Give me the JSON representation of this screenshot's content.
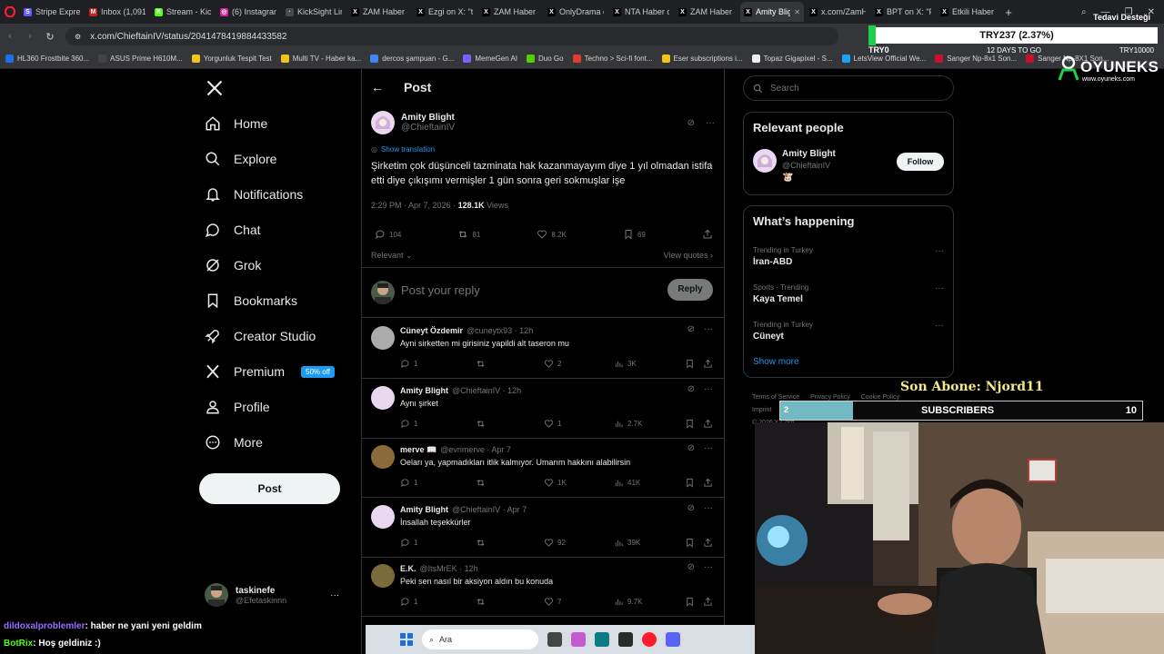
{
  "browser": {
    "tabs": [
      {
        "label": "Stripe Express",
        "color": "#635bff",
        "glyph": "S"
      },
      {
        "label": "Inbox (1,091)",
        "color": "#c5221f",
        "glyph": "M"
      },
      {
        "label": "Stream - Kick",
        "color": "#53fc18",
        "glyph": "K"
      },
      {
        "label": "(6) Instagram",
        "color": "#d6249f",
        "glyph": "◎"
      },
      {
        "label": "KickSight Link",
        "color": "#4a4a4a",
        "glyph": "·"
      },
      {
        "label": "ZAM Haber on",
        "color": "#000000",
        "glyph": "X"
      },
      {
        "label": "Ezgi on X: \"th",
        "color": "#000000",
        "glyph": "X"
      },
      {
        "label": "ZAM Haber on",
        "color": "#000000",
        "glyph": "X"
      },
      {
        "label": "OnlyDrama on",
        "color": "#000000",
        "glyph": "X"
      },
      {
        "label": "NTA Haber on",
        "color": "#000000",
        "glyph": "X"
      },
      {
        "label": "ZAM Haber on",
        "color": "#000000",
        "glyph": "X"
      },
      {
        "label": "Amity Blight on X: \"Şirk",
        "color": "#000000",
        "glyph": "X",
        "active": true
      },
      {
        "label": "x.com/ZamHa",
        "color": "#000000",
        "glyph": "X"
      },
      {
        "label": "BPT on X: \"Flo",
        "color": "#000000",
        "glyph": "X"
      },
      {
        "label": "Etkili Haber Y",
        "color": "#000000",
        "glyph": "X"
      }
    ],
    "url": "x.com/ChieftainIV/status/2041478419884433582",
    "bookmarks": [
      "HL360 Frostbite 360...",
      "ASUS Prime H610M...",
      "Yorgunluk Tespit Test",
      "Multi TV - Haber ka...",
      "dercos şampuan - G...",
      "MemeGen AI",
      "Duo Go",
      "Techno > Sci-fi font...",
      "Eser subscriptions i...",
      "Topaz Gigapixel - S...",
      "LetsView Official We...",
      "Sanger Np-8x1 Son...",
      "Sanger Np-8X1 Son..."
    ]
  },
  "stock_widget": {
    "title": "Tedavi Desteği",
    "value": "TRY237 (2.37%)",
    "low": "TRY0",
    "days": "12 DAYS TO GO",
    "high": "TRY10000",
    "progress": 0.0237
  },
  "brand": {
    "name": "OYUNEKS",
    "url": "www.oyuneks.com"
  },
  "nav": {
    "items": [
      {
        "label": "Home",
        "icon": "home-icon"
      },
      {
        "label": "Explore",
        "icon": "search-icon"
      },
      {
        "label": "Notifications",
        "icon": "bell-icon"
      },
      {
        "label": "Chat",
        "icon": "chat-icon"
      },
      {
        "label": "Grok",
        "icon": "grok-icon"
      },
      {
        "label": "Bookmarks",
        "icon": "bookmark-icon"
      },
      {
        "label": "Creator Studio",
        "icon": "rocket-icon"
      },
      {
        "label": "Premium",
        "icon": "x-logo-icon"
      },
      {
        "label": "Profile",
        "icon": "person-icon"
      },
      {
        "label": "More",
        "icon": "more-circle-icon"
      }
    ],
    "premium_badge": "50% off",
    "post_button": "Post",
    "me": {
      "name": "taskinefe",
      "handle": "@Efetaskinnn"
    }
  },
  "post": {
    "header": "Post",
    "author": "Amity Blight",
    "handle": "@ChieftainIV",
    "show_translation": "Show translation",
    "text": "Şirketim çok düşünceli tazminata hak kazanmayayım diye 1 yıl olmadan istifa etti diye çıkışımı vermişler 1 gün sonra geri sokmuşlar işe",
    "time": "2:29 PM · Apr 7, 2026 · ",
    "views_count": "128.1K",
    "views_label": " Views",
    "replies": "104",
    "reposts": "81",
    "likes": "8.2K",
    "bookmarks": "69",
    "sort": "Relevant",
    "view_quotes": "View quotes",
    "reply_placeholder": "Post your reply",
    "reply_button": "Reply"
  },
  "replies": [
    {
      "name": "Cüneyt Özdemir",
      "handle": "@cuneytx93 · 12h",
      "text": "Ayni sirketten mi girisiniz yapildi alt taseron mu",
      "r": "1",
      "rt": "",
      "l": "2",
      "v": "3K"
    },
    {
      "name": "Amity Blight",
      "handle": "@ChieftainIV · 12h",
      "text": "Aynı şirket",
      "r": "1",
      "rt": "",
      "l": "1",
      "v": "2.7K"
    },
    {
      "name": "merve 📖",
      "handle": "@evrimerve · Apr 7",
      "text": "Oeları ya, yapmadıkları itlik kalmıyor. Umarım hakkını alabilirsin",
      "r": "1",
      "rt": "",
      "l": "1K",
      "v": "41K"
    },
    {
      "name": "Amity Blight",
      "handle": "@ChieftainIV · Apr 7",
      "text": "İnsallah teşekkürler",
      "r": "1",
      "rt": "",
      "l": "92",
      "v": "39K"
    },
    {
      "name": "E.K.",
      "handle": "@ItsMrEK · 12h",
      "text": "Peki sen nasıl bir aksiyon aldın bu konuda",
      "r": "1",
      "rt": "",
      "l": "7",
      "v": "9.7K"
    }
  ],
  "sidebar": {
    "search_placeholder": "Search",
    "relevant_title": "Relevant people",
    "person": {
      "name": "Amity Blight",
      "handle": "@ChieftainIV",
      "emoji": "🐮",
      "follow": "Follow"
    },
    "happening_title": "What’s happening",
    "trends": [
      {
        "context": "Trending in Turkey",
        "topic": "İran-ABD"
      },
      {
        "context": "Sports · Trending",
        "topic": "Kaya Temel"
      },
      {
        "context": "Trending in Turkey",
        "topic": "Cüneyt"
      }
    ],
    "show_more": "Show more",
    "footer_links": [
      "Terms of Service",
      "Privacy Policy",
      "Cookie Policy",
      "Imprint",
      "Info",
      "More ..."
    ],
    "footer_copy": "© 2026 X Corp."
  },
  "overlay": {
    "son_abone": "Son Abone: Njord11",
    "subs_current": "2",
    "subs_label": "SUBSCRIBERS",
    "subs_target": "10",
    "subs_progress": 0.2,
    "chat": [
      {
        "user": "dildoxalproblemler",
        "msg": ": haber ne yani yeni geldim",
        "color": "#9b6bff"
      },
      {
        "user": "BotRix",
        "msg": ": Hoş geldiniz :)",
        "color": "#53fc18"
      }
    ]
  },
  "taskbar": {
    "search": "Ara"
  }
}
